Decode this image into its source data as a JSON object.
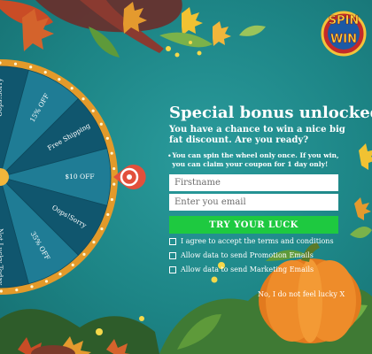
{
  "brand": {
    "logo_line1": "SPIN",
    "logo_line2": "WIN"
  },
  "heading": "Special bonus unlocked",
  "subheading": "You have a chance to win a nice big fat discount. Are you ready?",
  "note": "You can spin the wheel only once. If you win, you can claim your coupon for 1 day only!",
  "form": {
    "firstname_placeholder": "Firstname",
    "email_placeholder": "Enter you email",
    "submit_label": "TRY YOUR LUCK"
  },
  "checkboxes": [
    {
      "label": "I agree to accept the terms and conditions",
      "checked": false
    },
    {
      "label": "Allow data to send Promotion Emails",
      "checked": false
    },
    {
      "label": "Allow data to send Marketing Emails",
      "checked": false
    }
  ],
  "dismiss": {
    "label": "No, I do not feel lucky",
    "close_glyph": "X"
  },
  "wheel": {
    "segments": [
      "Oops!Sorry",
      "15% OFF",
      "Free Shipping",
      "$10 OFF",
      "Oops!Sorry",
      "35% OFF",
      "Not Lucky Today"
    ],
    "pointer_color": "#e2503c",
    "rim_color": "#e39a2a"
  },
  "colors": {
    "background": "#1d8586",
    "accent": "#1ec940",
    "wheel_dark": "#10566e",
    "wheel_light": "#1f7c95"
  }
}
